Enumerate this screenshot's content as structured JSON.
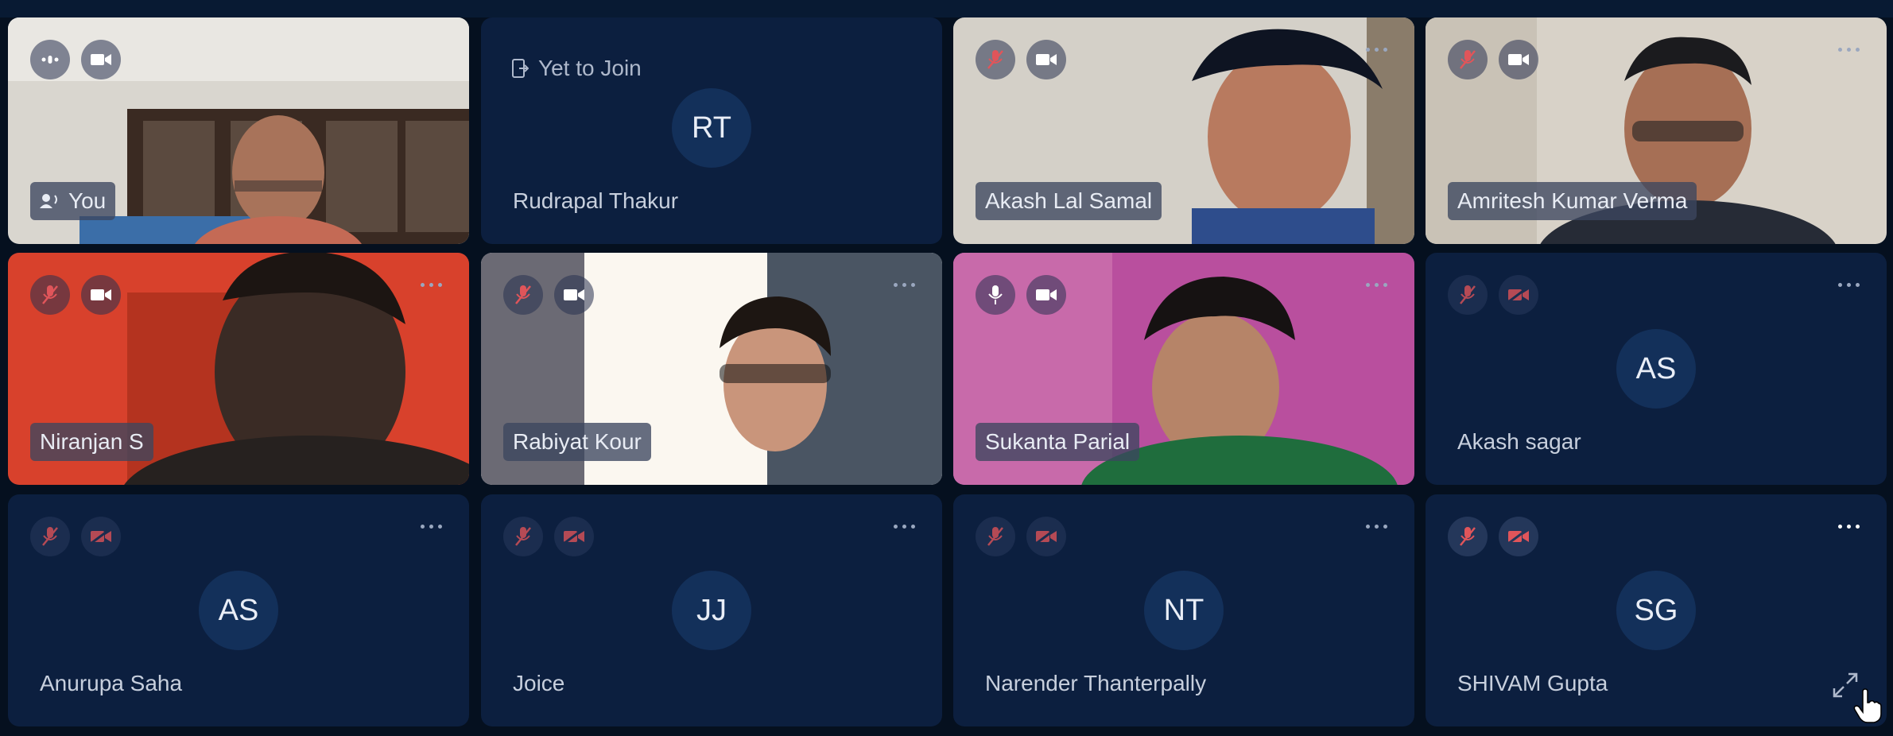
{
  "colors": {
    "background": "#05101f",
    "tile": "#0c1f3f",
    "avatar_circle": "#13305a",
    "muted_red": "#e0555a",
    "icon_gray": "#aeb8cb"
  },
  "participants": [
    {
      "name": "You",
      "type": "video",
      "mic": "speaking",
      "camera": "on",
      "scene": "room-bookshelf"
    },
    {
      "name": "Rudrapal Thakur",
      "type": "avatar",
      "initials": "RT",
      "status": "Yet to Join"
    },
    {
      "name": "Akash Lal Samal",
      "type": "video",
      "mic": "muted",
      "camera": "on",
      "scene": "person-looking-down"
    },
    {
      "name": "Amritesh Kumar Verma",
      "type": "video",
      "mic": "muted",
      "camera": "on",
      "scene": "person-glasses-room"
    },
    {
      "name": "Niranjan S",
      "type": "video",
      "mic": "muted",
      "camera": "on",
      "scene": "red-wall-person"
    },
    {
      "name": "Rabiyat Kour",
      "type": "video",
      "mic": "muted",
      "camera": "on",
      "scene": "bright-window-person"
    },
    {
      "name": "Sukanta Parial",
      "type": "video",
      "mic": "on",
      "camera": "on",
      "scene": "pink-wall-person"
    },
    {
      "name": "Akash sagar",
      "type": "avatar",
      "initials": "AS",
      "mic": "muted",
      "camera": "off"
    },
    {
      "name": "Anurupa Saha",
      "type": "avatar",
      "initials": "AS",
      "mic": "muted",
      "camera": "off"
    },
    {
      "name": "Joice",
      "type": "avatar",
      "initials": "JJ",
      "mic": "muted",
      "camera": "off"
    },
    {
      "name": "Narender Thanterpally",
      "type": "avatar",
      "initials": "NT",
      "mic": "muted",
      "camera": "off"
    },
    {
      "name": "SHIVAM Gupta",
      "type": "avatar",
      "initials": "SG",
      "mic": "muted",
      "camera": "off",
      "hovered": true
    }
  ]
}
